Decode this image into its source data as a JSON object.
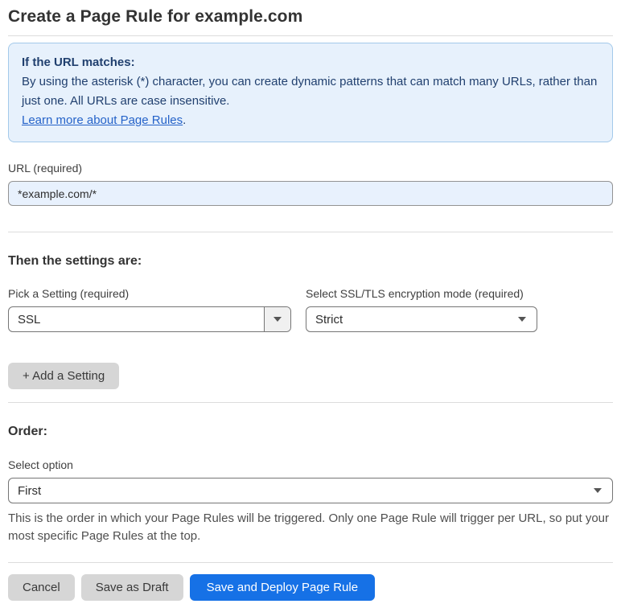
{
  "page": {
    "title": "Create a Page Rule for example.com"
  },
  "info_box": {
    "heading": "If the URL matches:",
    "body": "By using the asterisk (*) character, you can create dynamic patterns that can match many URLs, rather than just one. All URLs are case insensitive.",
    "link": "Learn more about Page Rules",
    "link_suffix": "."
  },
  "url_field": {
    "label": "URL (required)",
    "value": "*example.com/*"
  },
  "settings_section": {
    "heading": "Then the settings are:",
    "setting_picker": {
      "label": "Pick a Setting (required)",
      "value": "SSL"
    },
    "mode_picker": {
      "label": "Select SSL/TLS encryption mode (required)",
      "value": "Strict"
    },
    "add_setting_label": "+ Add a Setting"
  },
  "order_section": {
    "heading": "Order:",
    "select_label": "Select option",
    "value": "First",
    "help_text": "This is the order in which your Page Rules will be triggered. Only one Page Rule will trigger per URL, so put your most specific Page Rules at the top."
  },
  "footer": {
    "cancel_label": "Cancel",
    "save_draft_label": "Save as Draft",
    "save_deploy_label": "Save and Deploy Page Rule"
  },
  "icons": {
    "dropdown_arrow": "chevron-down-icon"
  },
  "colors": {
    "accent_blue": "#1671e6",
    "info_box_bg": "#e7f1fc",
    "info_box_border": "#a3c9ea",
    "info_box_text": "#21406f",
    "link_blue": "#2563c9",
    "url_input_bg": "#e8f1fd",
    "gray_button_bg": "#d6d6d6",
    "divider": "#dcdcdc"
  }
}
